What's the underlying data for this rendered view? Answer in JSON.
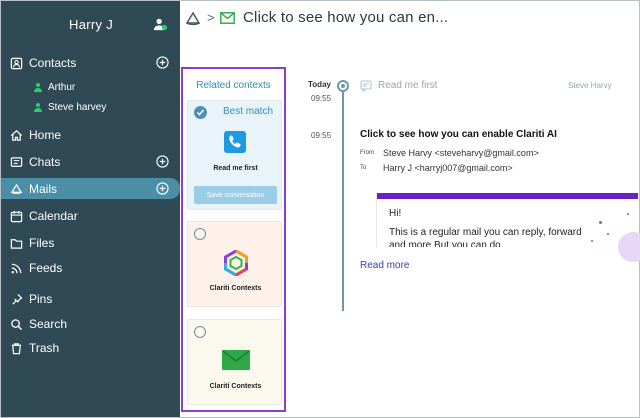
{
  "user": {
    "name": "Harry J"
  },
  "sidebar": {
    "contacts": {
      "label": "Contacts",
      "items": [
        {
          "name": "Arthur"
        },
        {
          "name": "Steve harvey"
        }
      ]
    },
    "items": [
      {
        "label": "Home",
        "icon": "home-icon"
      },
      {
        "label": "Chats",
        "icon": "chat-icon"
      },
      {
        "label": "Mails",
        "icon": "mail-logo-icon",
        "active": true
      },
      {
        "label": "Calendar",
        "icon": "calendar-icon"
      },
      {
        "label": "Files",
        "icon": "folder-icon"
      },
      {
        "label": "Feeds",
        "icon": "rss-icon"
      },
      {
        "label": "Pins",
        "icon": "pin-icon"
      },
      {
        "label": "Search",
        "icon": "search-icon"
      },
      {
        "label": "Trash",
        "icon": "trash-icon"
      }
    ],
    "active_color": "#4a8fa5",
    "bg_color": "#2f4a55"
  },
  "header": {
    "title": "Click to see how you can en...",
    "separator": ">"
  },
  "related_contexts": {
    "title": "Related contexts",
    "highlight_color": "#8b3fd1",
    "cards": [
      {
        "badge": "Best match",
        "label": "Read me first",
        "button": "Save conversation",
        "selected": true,
        "icon": "phone-icon"
      },
      {
        "label": "Clariti Contexts",
        "selected": false,
        "icon": "hexagon-logo-icon"
      },
      {
        "label": "Clariti Contexts",
        "selected": false,
        "icon": "envelope-icon"
      }
    ]
  },
  "timeline": {
    "day": "Today",
    "entries": [
      {
        "time": "09:55",
        "type": "note",
        "text": "Read me first",
        "from": "Steve Harvy"
      },
      {
        "time": "09:55",
        "type": "mail",
        "subject": "Click to see how you can enable Clariti AI",
        "from_label": "From",
        "from": "Steve Harvy <steveharvy@gmail.com>",
        "to_label": "To",
        "to": "Harry J <harryj007@gmail.com>",
        "body_greeting": "Hi!",
        "body_text": "This is a regular mail you can reply, forward and more But you can do",
        "read_more": "Read more"
      }
    ]
  }
}
